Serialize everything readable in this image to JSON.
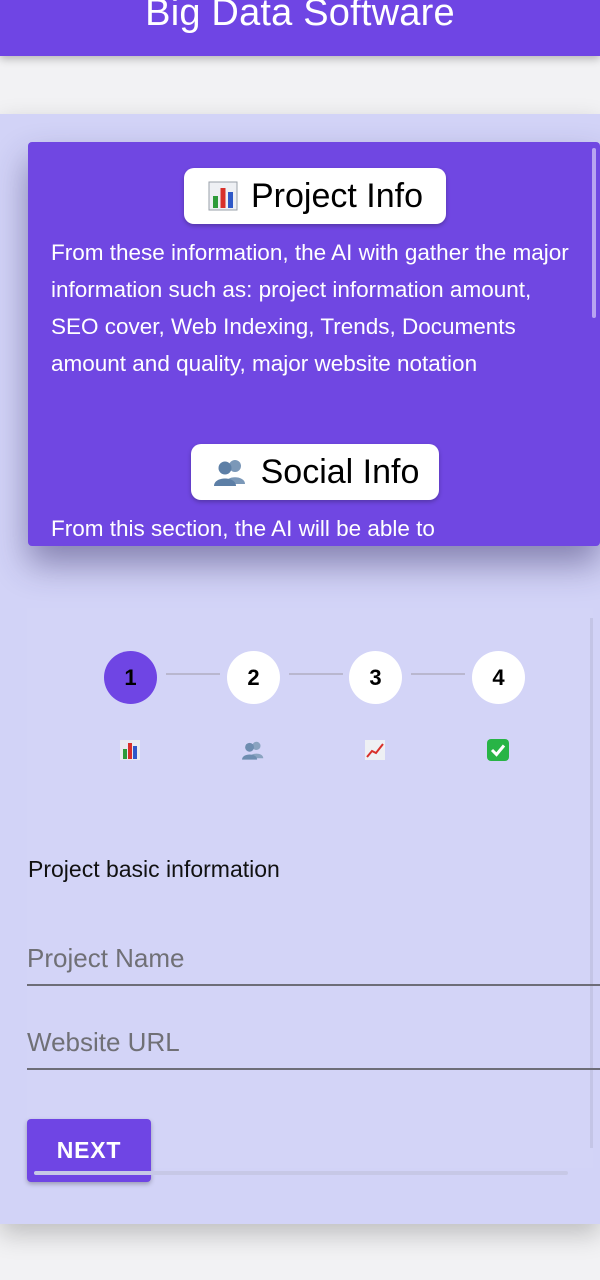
{
  "app_bar": {
    "title": "Big Data Software",
    "color": "#6f45e4"
  },
  "info_card": {
    "sections": [
      {
        "icon": "bar-chart-icon",
        "title": "Project Info",
        "text": "From these information, the AI with gather the major information such as: project information amount, SEO cover, Web Indexing, Trends, Documents amount and quality, major website notation"
      },
      {
        "icon": "users-icon",
        "title": "Social Info",
        "text": "From this section, the AI will be able to"
      }
    ]
  },
  "stepper": {
    "active_step": 1,
    "steps": [
      {
        "number": "1",
        "icon": "bar-chart-icon"
      },
      {
        "number": "2",
        "icon": "users-icon"
      },
      {
        "number": "3",
        "icon": "trend-up-icon"
      },
      {
        "number": "4",
        "icon": "check-icon"
      }
    ]
  },
  "form": {
    "title": "Project basic information",
    "project_name": {
      "placeholder": "Project Name",
      "value": ""
    },
    "website_url": {
      "placeholder": "Website URL",
      "value": ""
    },
    "next_label": "NEXT"
  },
  "colors": {
    "accent": "#6f45e4",
    "panel": "#d2d3f7",
    "check": "#28b446"
  }
}
